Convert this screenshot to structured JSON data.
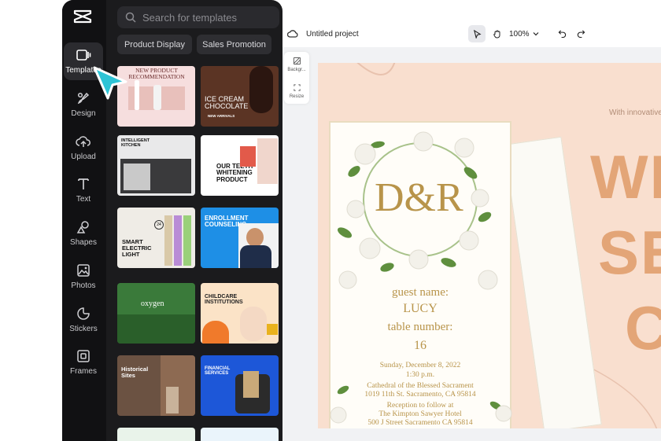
{
  "sidebar": {
    "items": [
      {
        "label": "Templates",
        "icon": "templates-icon"
      },
      {
        "label": "Design",
        "icon": "design-icon"
      },
      {
        "label": "Upload",
        "icon": "upload-icon"
      },
      {
        "label": "Text",
        "icon": "text-icon"
      },
      {
        "label": "Shapes",
        "icon": "shapes-icon"
      },
      {
        "label": "Photos",
        "icon": "photos-icon"
      },
      {
        "label": "Stickers",
        "icon": "stickers-icon"
      },
      {
        "label": "Frames",
        "icon": "frames-icon"
      }
    ]
  },
  "templates": {
    "search_placeholder": "Search for templates",
    "chips": [
      "Product Display",
      "Sales Promotion"
    ],
    "thumbs": [
      {
        "text": "NEW PRODUCT RECOMMENDATION"
      },
      {
        "text": "ICE CREAM CHOCOLATE",
        "sub": "NEW ARRIVALS"
      },
      {
        "text": "INTELLIGENT KITCHEN"
      },
      {
        "text": "OUR TEETH WHITENING PRODUCT"
      },
      {
        "text": "SMART ELECTRIC LIGHT",
        "sub": "24"
      },
      {
        "text": "ENROLLMENT COUNSELING"
      },
      {
        "text": "oxygen"
      },
      {
        "text": "CHILDCARE INSTITUTIONS"
      },
      {
        "text": "Historical Sites"
      },
      {
        "text": "FINANCIAL SERVICES"
      }
    ]
  },
  "topbar": {
    "project_title": "Untitled project",
    "zoom": "100%"
  },
  "sidetools": {
    "background_label": "Backgr...",
    "resize_label": "Resize"
  },
  "canvas": {
    "tagline": "With innovative f",
    "big_lines": [
      "WE",
      "SEA",
      "CI"
    ],
    "invite": {
      "monogram": "D&R",
      "guest_label": "guest name:",
      "guest_value": "LUCY",
      "table_label": "table number:",
      "table_value": "16",
      "date": "Sunday, December 8, 2022",
      "time": "1:30 p.m.",
      "venue": "Cathedral of the Blessed Sacrament",
      "address": "1019 11th St. Sacramento, CA 95814",
      "reception": "Reception to follow at",
      "hotel": "The Kimpton Sawyer Hotel",
      "hotel_address": "500 J Street Sacramento CA 95814"
    }
  },
  "colors": {
    "panel": "#1b1b1d",
    "rail": "#111113",
    "accent_cursor": "#2ec4d6",
    "artboard_bg": "#f9dfcf",
    "gold": "#b8944a",
    "headline": "#e3a577"
  }
}
